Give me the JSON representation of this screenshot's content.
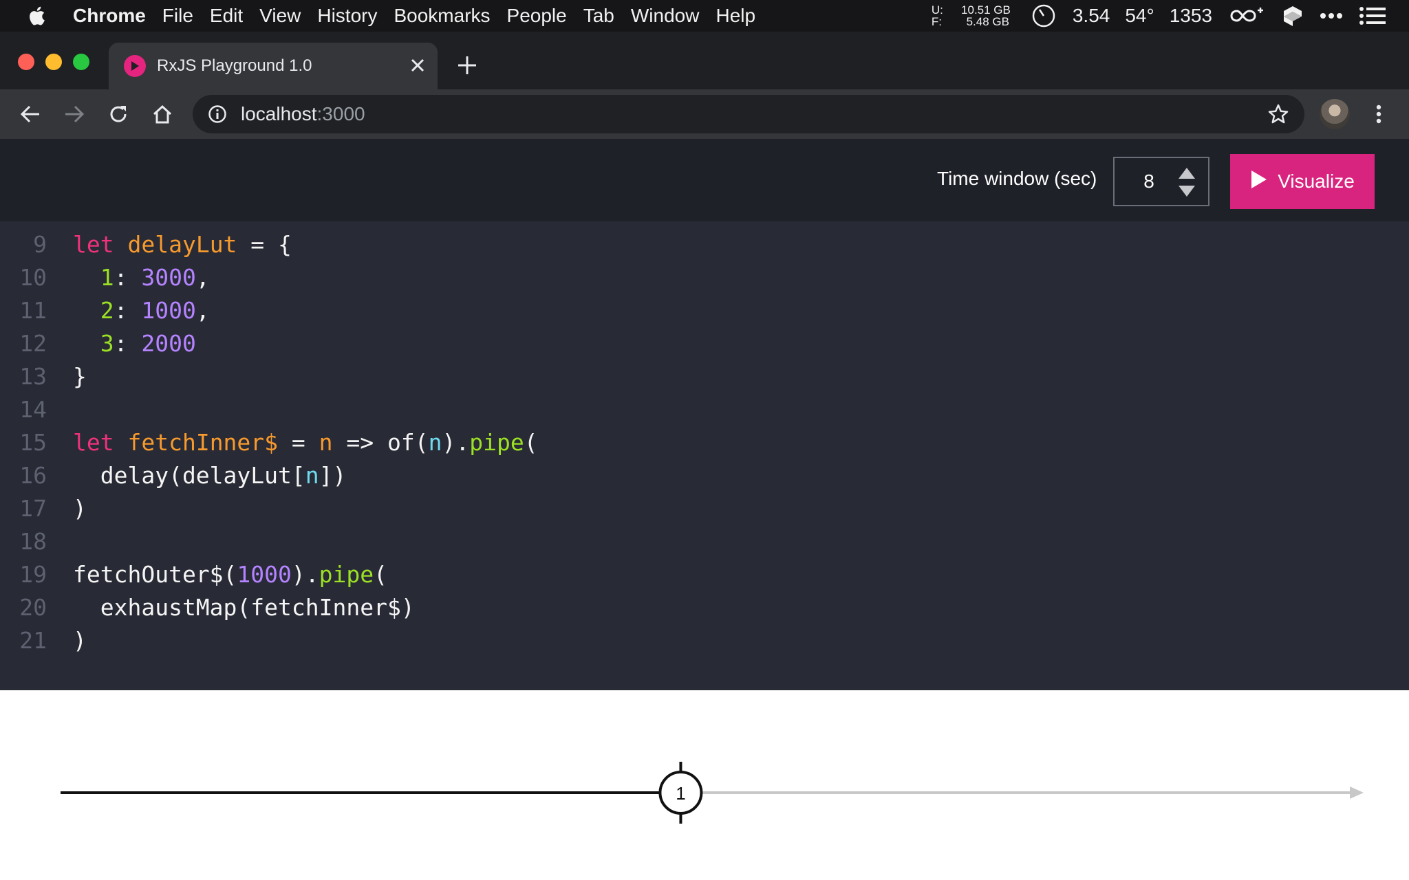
{
  "menubar": {
    "app_name": "Chrome",
    "items": [
      "File",
      "Edit",
      "View",
      "History",
      "Bookmarks",
      "People",
      "Tab",
      "Window",
      "Help"
    ],
    "memory": {
      "u_label": "U:",
      "u_value": "10.51 GB",
      "f_label": "F:",
      "f_value": "5.48 GB"
    },
    "load": "3.54",
    "temp": "54°",
    "rpm": "1353"
  },
  "browser": {
    "tab_title": "RxJS Playground 1.0",
    "url_host": "localhost",
    "url_port": ":3000"
  },
  "controls": {
    "time_window_label": "Time window (sec)",
    "time_window_value": "8",
    "visualize_label": "Visualize"
  },
  "editor": {
    "lines": [
      {
        "num": "9",
        "tokens": [
          [
            "k",
            "let"
          ],
          [
            "",
            "  "
          ],
          [
            "v",
            "delayLut"
          ],
          [
            "",
            " = {"
          ]
        ]
      },
      {
        "num": "10",
        "tokens": [
          [
            "",
            ""
          ],
          [
            "p",
            "  1"
          ],
          [
            "",
            ": "
          ],
          [
            "n",
            "3000"
          ],
          [
            "",
            ","
          ]
        ]
      },
      {
        "num": "11",
        "tokens": [
          [
            "p",
            "  2"
          ],
          [
            "",
            ": "
          ],
          [
            "n",
            "1000"
          ],
          [
            "",
            ","
          ]
        ]
      },
      {
        "num": "12",
        "tokens": [
          [
            "p",
            "  3"
          ],
          [
            "",
            ": "
          ],
          [
            "n",
            "2000"
          ]
        ]
      },
      {
        "num": "13",
        "tokens": [
          [
            "",
            "}"
          ]
        ]
      },
      {
        "num": "14",
        "tokens": []
      },
      {
        "num": "15",
        "tokens": [
          [
            "k",
            "let"
          ],
          [
            "",
            " "
          ],
          [
            "v",
            "fetchInner$"
          ],
          [
            "",
            " = "
          ],
          [
            "v",
            "n"
          ],
          [
            "",
            " => of("
          ],
          [
            "a",
            "n"
          ],
          [
            "",
            ")."
          ],
          [
            "p",
            "pipe"
          ],
          [
            "",
            "("
          ]
        ]
      },
      {
        "num": "16",
        "tokens": [
          [
            "",
            "  delay(delayLut["
          ],
          [
            "a",
            "n"
          ],
          [
            "",
            "])"
          ]
        ]
      },
      {
        "num": "17",
        "tokens": [
          [
            "",
            ")"
          ]
        ]
      },
      {
        "num": "18",
        "tokens": []
      },
      {
        "num": "19",
        "tokens": [
          [
            "",
            "fetchOuter$("
          ],
          [
            "n",
            "1000"
          ],
          [
            "",
            ")."
          ],
          [
            "p",
            "pipe"
          ],
          [
            "",
            "("
          ]
        ]
      },
      {
        "num": "20",
        "tokens": [
          [
            "",
            "  exhaustMap(fetchInner$)"
          ]
        ]
      },
      {
        "num": "21",
        "tokens": [
          [
            "",
            ")"
          ]
        ]
      }
    ]
  },
  "marble": {
    "emission_label": "1",
    "progress_fraction": 0.48
  }
}
